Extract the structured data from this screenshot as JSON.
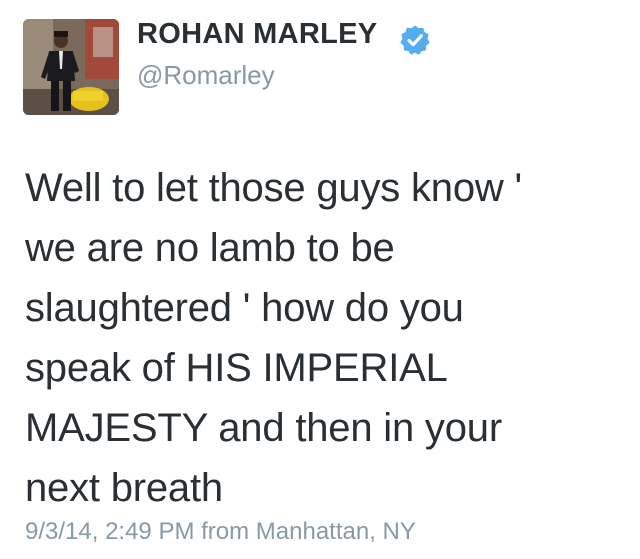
{
  "tweet": {
    "author": {
      "display_name": "ROHAN MARLEY",
      "handle": "@Romarley",
      "verified": true,
      "verified_icon": "verified-badge-icon",
      "verified_color": "#55acee"
    },
    "text": "Well to let those guys know '\nwe are no lamb to be\nslaughtered ' how do you\nspeak of HIS IMPERIAL\nMAJESTY and then in your\nnext breath",
    "timestamp": "9/3/14, 2:49 PM",
    "source_prefix": "from",
    "location": "Manhattan, NY"
  },
  "colors": {
    "text": "#292f33",
    "secondary": "#8899a6",
    "accent": "#55acee"
  }
}
